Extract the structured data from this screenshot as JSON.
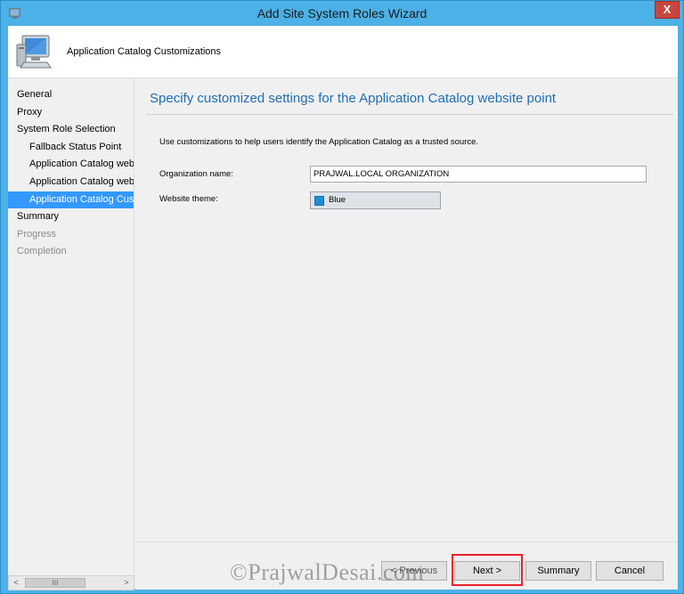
{
  "window": {
    "title": "Add Site System Roles Wizard",
    "close_glyph": "X"
  },
  "header": {
    "title": "Application Catalog Customizations",
    "icon": "computer-icon"
  },
  "sidebar": {
    "items": [
      {
        "label": "General",
        "state": "normal",
        "level": 0
      },
      {
        "label": "Proxy",
        "state": "normal",
        "level": 0
      },
      {
        "label": "System Role Selection",
        "state": "normal",
        "level": 0
      },
      {
        "label": "Fallback Status Point",
        "state": "normal",
        "level": 1
      },
      {
        "label": "Application Catalog web",
        "state": "normal",
        "level": 1
      },
      {
        "label": "Application Catalog webs",
        "state": "normal",
        "level": 1
      },
      {
        "label": "Application Catalog Cust",
        "state": "selected",
        "level": 1
      },
      {
        "label": "Summary",
        "state": "normal",
        "level": 0
      },
      {
        "label": "Progress",
        "state": "disabled",
        "level": 0
      },
      {
        "label": "Completion",
        "state": "disabled",
        "level": 0
      }
    ],
    "scroll": {
      "left_glyph": "<",
      "right_glyph": ">",
      "thumb_glyph": "III"
    }
  },
  "content": {
    "title": "Specify customized settings for the Application Catalog website point",
    "description": "Use customizations to help users identify the Application Catalog as a trusted source.",
    "org_label": "Organization name:",
    "org_value": "PRAJWAL.LOCAL ORGANIZATION",
    "theme_label": "Website theme:",
    "theme_value": "Blue",
    "theme_color": "#1b8fd8"
  },
  "footer": {
    "prev_label": "< Previous",
    "next_label": "Next >",
    "summary_label": "Summary",
    "cancel_label": "Cancel"
  },
  "watermark": "©PrajwalDesai.com",
  "colors": {
    "frame": "#4cb1e6",
    "selected": "#3399ff",
    "title_blue": "#1f6eb5",
    "highlight": "#e8202a"
  }
}
